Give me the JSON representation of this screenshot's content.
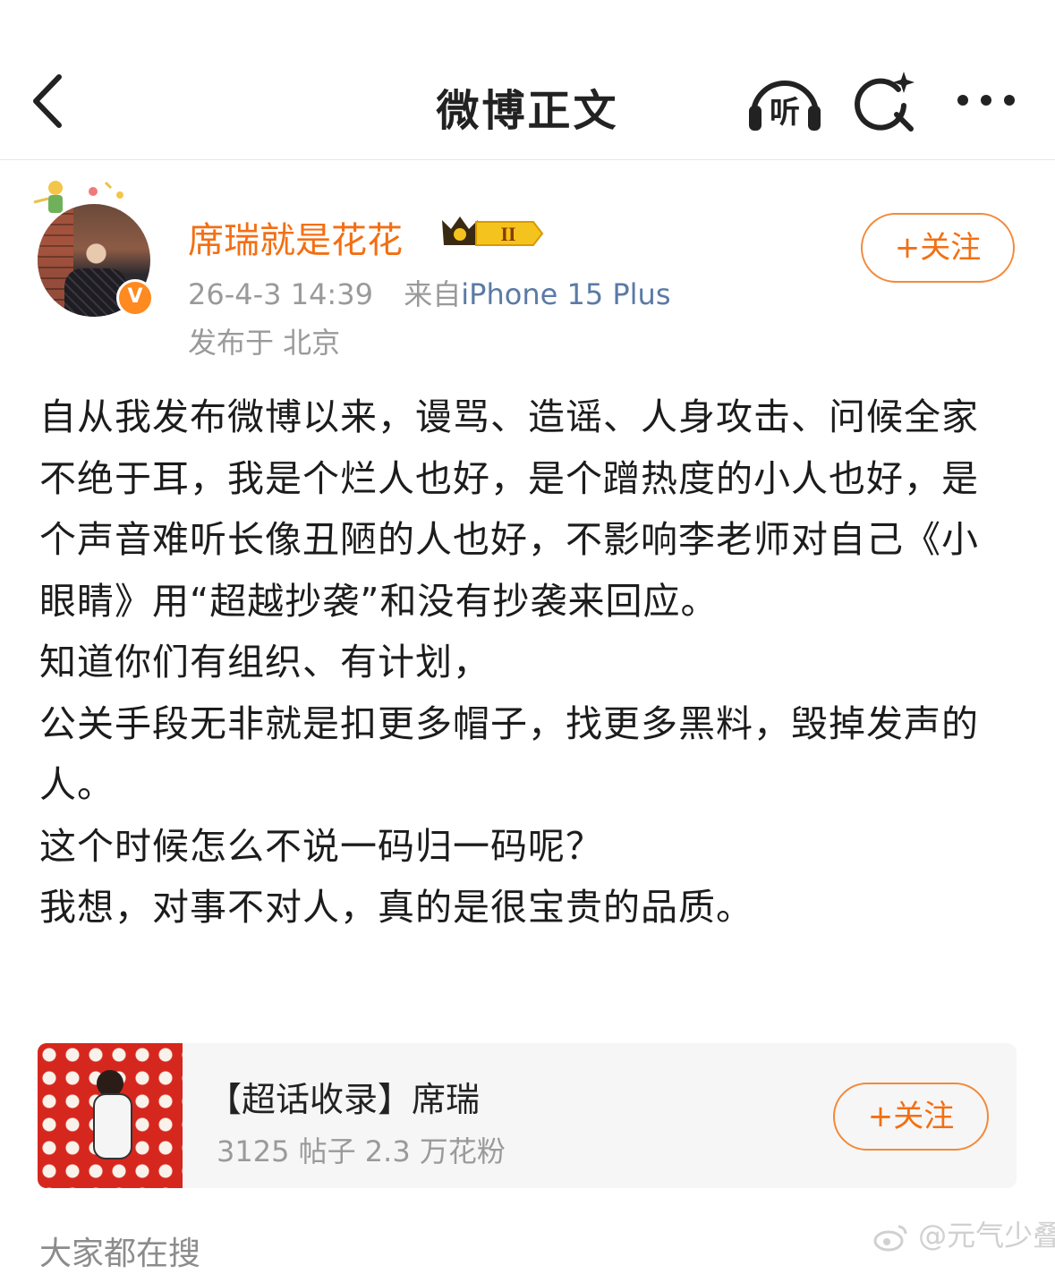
{
  "header": {
    "title": "微博正文",
    "listen_label": "听",
    "icons": [
      "back-icon",
      "headphones-icon",
      "ai-search-icon",
      "more-icon"
    ]
  },
  "author": {
    "name": "席瑞就是花花",
    "member_level": "II",
    "verified_mark": "V",
    "timestamp": "26-4-3 14:39",
    "source_prefix": "来自",
    "device": "iPhone 15 Plus",
    "location": "发布于 北京",
    "follow_label": "+关注"
  },
  "post": {
    "paragraphs": [
      "自从我发布微博以来，谩骂、造谣、人身攻击、问候全家不绝于耳，我是个烂人也好，是个蹭热度的小人也好，是个声音难听长像丑陋的人也好，不影响李老师对自己《小眼睛》用“超越抄袭”和没有抄袭来回应。",
      "知道你们有组织、有计划，",
      "公关手段无非就是扣更多帽子，找更多黑料，毁掉发声的人。",
      "这个时候怎么不说一码归一码呢？",
      "我想，对事不对人，真的是很宝贵的品质。"
    ]
  },
  "topic_card": {
    "title": "【超话收录】席瑞",
    "stats": "3125 帖子 2.3 万花粉",
    "follow_label": "+关注"
  },
  "footer": {
    "search_hint": "大家都在搜",
    "watermark": "@元气少叠"
  },
  "colors": {
    "accent_orange": "#f36f13",
    "follow_border": "#f28a3c",
    "device_blue": "#5b7aa6",
    "meta_gray": "#9a9a9a"
  }
}
